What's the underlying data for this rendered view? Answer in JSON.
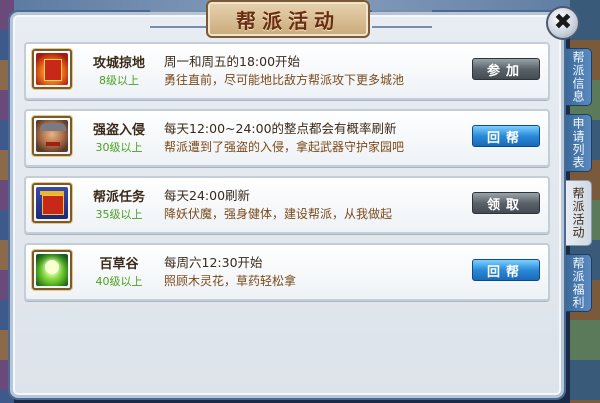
{
  "window": {
    "title": "帮派活动",
    "close_label": "✖"
  },
  "side_tabs": [
    {
      "label": "帮派信息",
      "active": false
    },
    {
      "label": "申请列表",
      "active": false
    },
    {
      "label": "帮派活动",
      "active": true
    },
    {
      "label": "帮派福利",
      "active": false
    }
  ],
  "activities": [
    {
      "name": "攻城掠地",
      "level": "8级以上",
      "time": "周一和周五的18:00开始",
      "description": "勇往直前，尽可能地比敌方帮派攻下更多城池",
      "button": "参加",
      "button_style": "grey",
      "icon": "city-siege-icon"
    },
    {
      "name": "强盗入侵",
      "level": "30级以上",
      "time": "每天12:00~24:00的整点都会有概率刷新",
      "description": "帮派遭到了强盗的入侵，拿起武器守护家园吧",
      "button": "回帮",
      "button_style": "blue",
      "icon": "bandit-icon"
    },
    {
      "name": "帮派任务",
      "level": "35级以上",
      "time": "每天24:00刷新",
      "description": "降妖伏魔，强身健体，建设帮派，从我做起",
      "button": "领取",
      "button_style": "grey",
      "icon": "guild-quest-icon"
    },
    {
      "name": "百草谷",
      "level": "40级以上",
      "time": "每周六12:30开始",
      "description": "照顾木灵花，草药轻松拿",
      "button": "回帮",
      "button_style": "blue",
      "icon": "herb-valley-icon"
    }
  ]
}
